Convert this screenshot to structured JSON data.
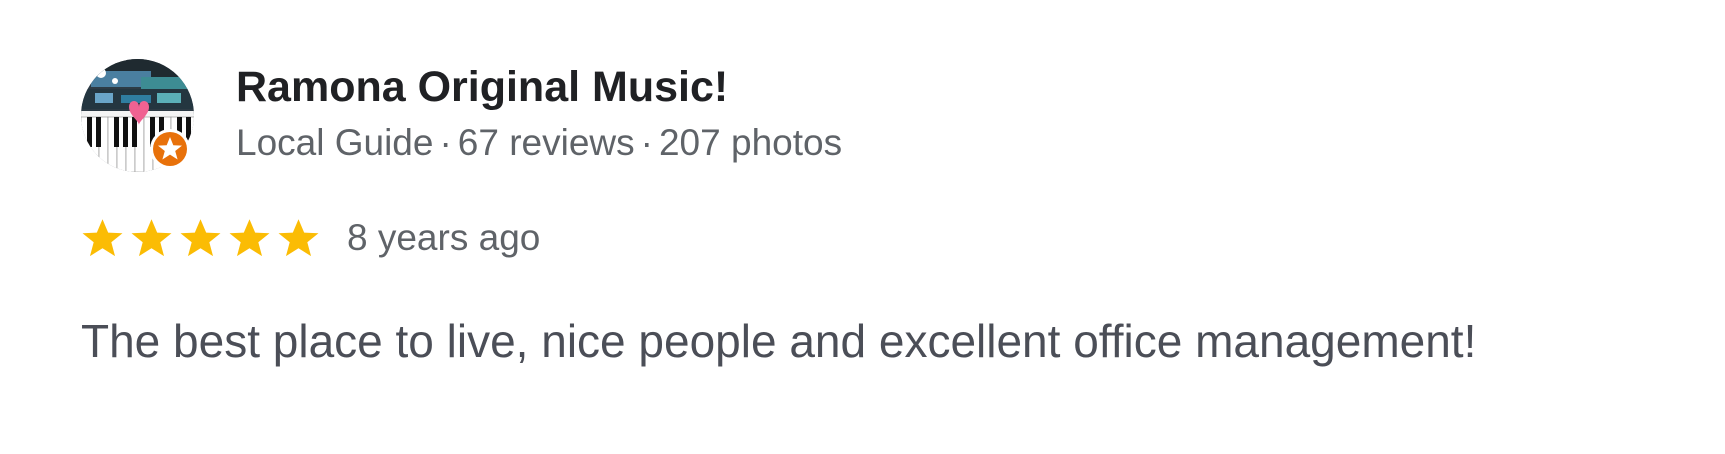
{
  "review": {
    "author": {
      "name": "Ramona Original Music!",
      "badge_icon": "local-guide-star-icon",
      "guide_label": "Local Guide",
      "separator": "·",
      "reviews": "67 reviews",
      "photos": "207 photos"
    },
    "rating": 5,
    "rating_max": 5,
    "time": "8 years ago",
    "text": "The best place to live, nice people and excellent office management!"
  },
  "colors": {
    "star": "#fbbc04",
    "badge": "#e8710a",
    "name": "#202124",
    "meta": "#5f6368",
    "body_text": "#4b4e57"
  }
}
